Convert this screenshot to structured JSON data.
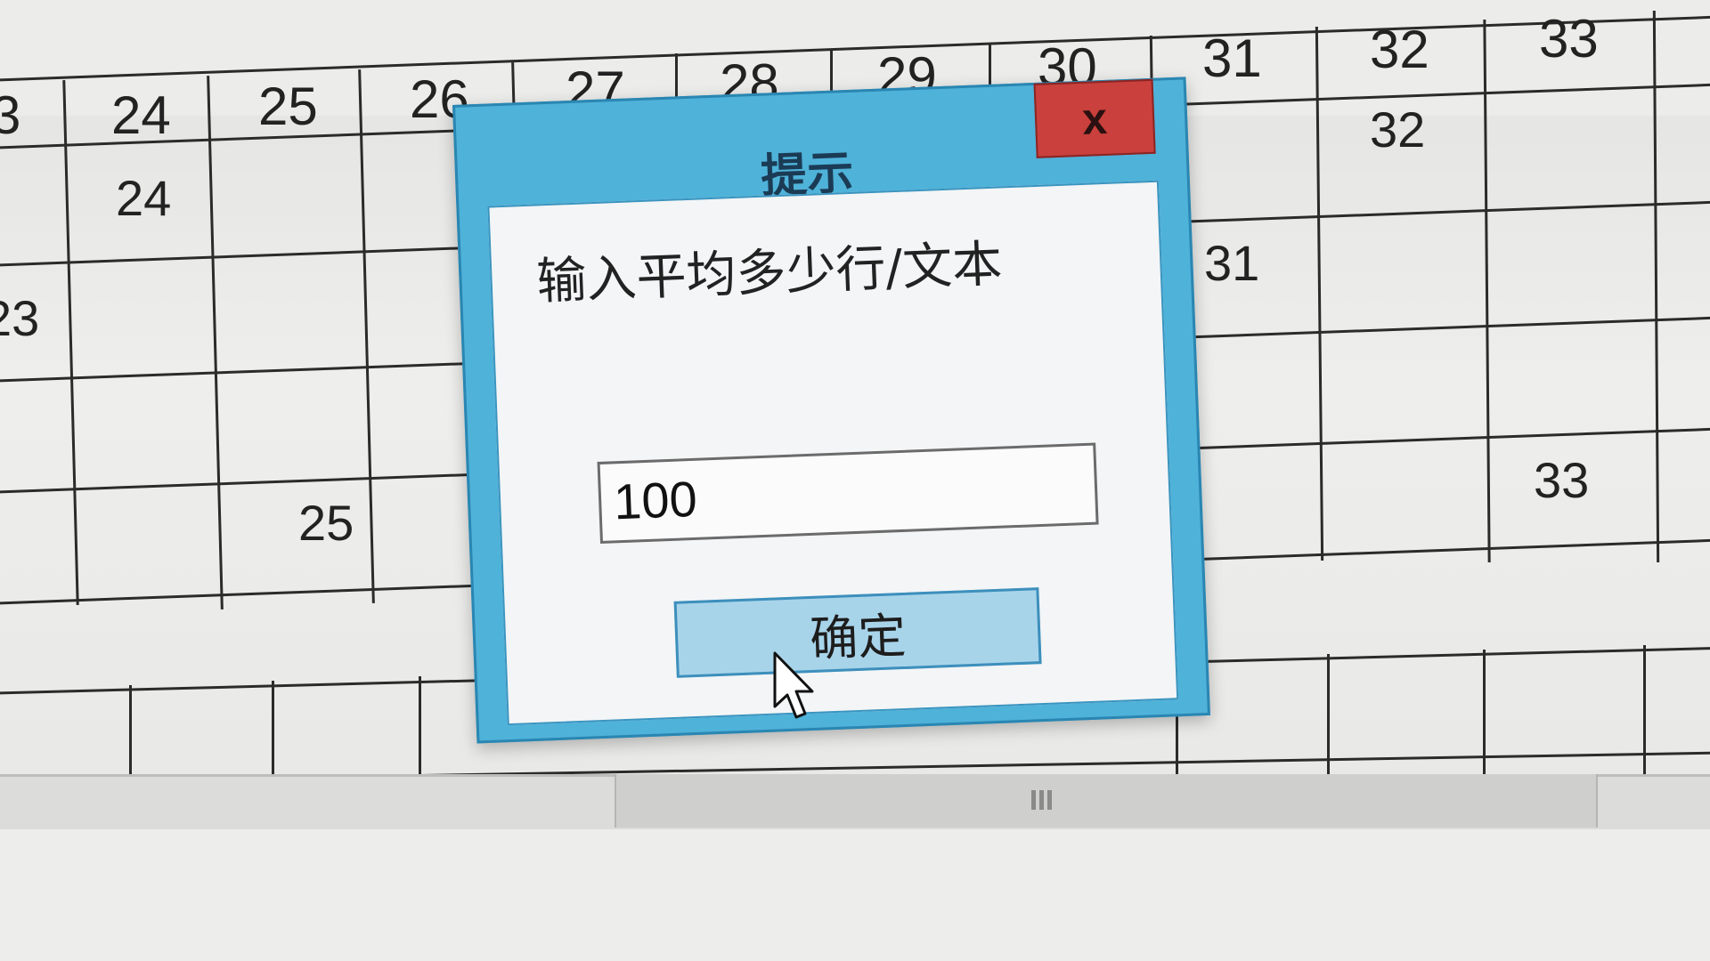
{
  "spreadsheet": {
    "column_headers": [
      "3",
      "24",
      "25",
      "26",
      "27",
      "28",
      "29",
      "30",
      "31",
      "32",
      "33"
    ],
    "cells": [
      {
        "text": "24"
      },
      {
        "text": "32"
      },
      {
        "text": "23"
      },
      {
        "text": "31"
      },
      {
        "text": "25"
      },
      {
        "text": "33"
      }
    ]
  },
  "dialog": {
    "title": "提示",
    "close_label": "x",
    "prompt": "输入平均多少行/文本",
    "input_value": "100",
    "ok_label": "确定"
  },
  "colors": {
    "dialog_frame": "#4fb2d9",
    "close_button": "#c9403c",
    "ok_button": "#a8d4ea"
  },
  "icons": {
    "close": "close-icon",
    "cursor": "mouse-pointer-icon",
    "grip": "scrollbar-grip-icon"
  }
}
